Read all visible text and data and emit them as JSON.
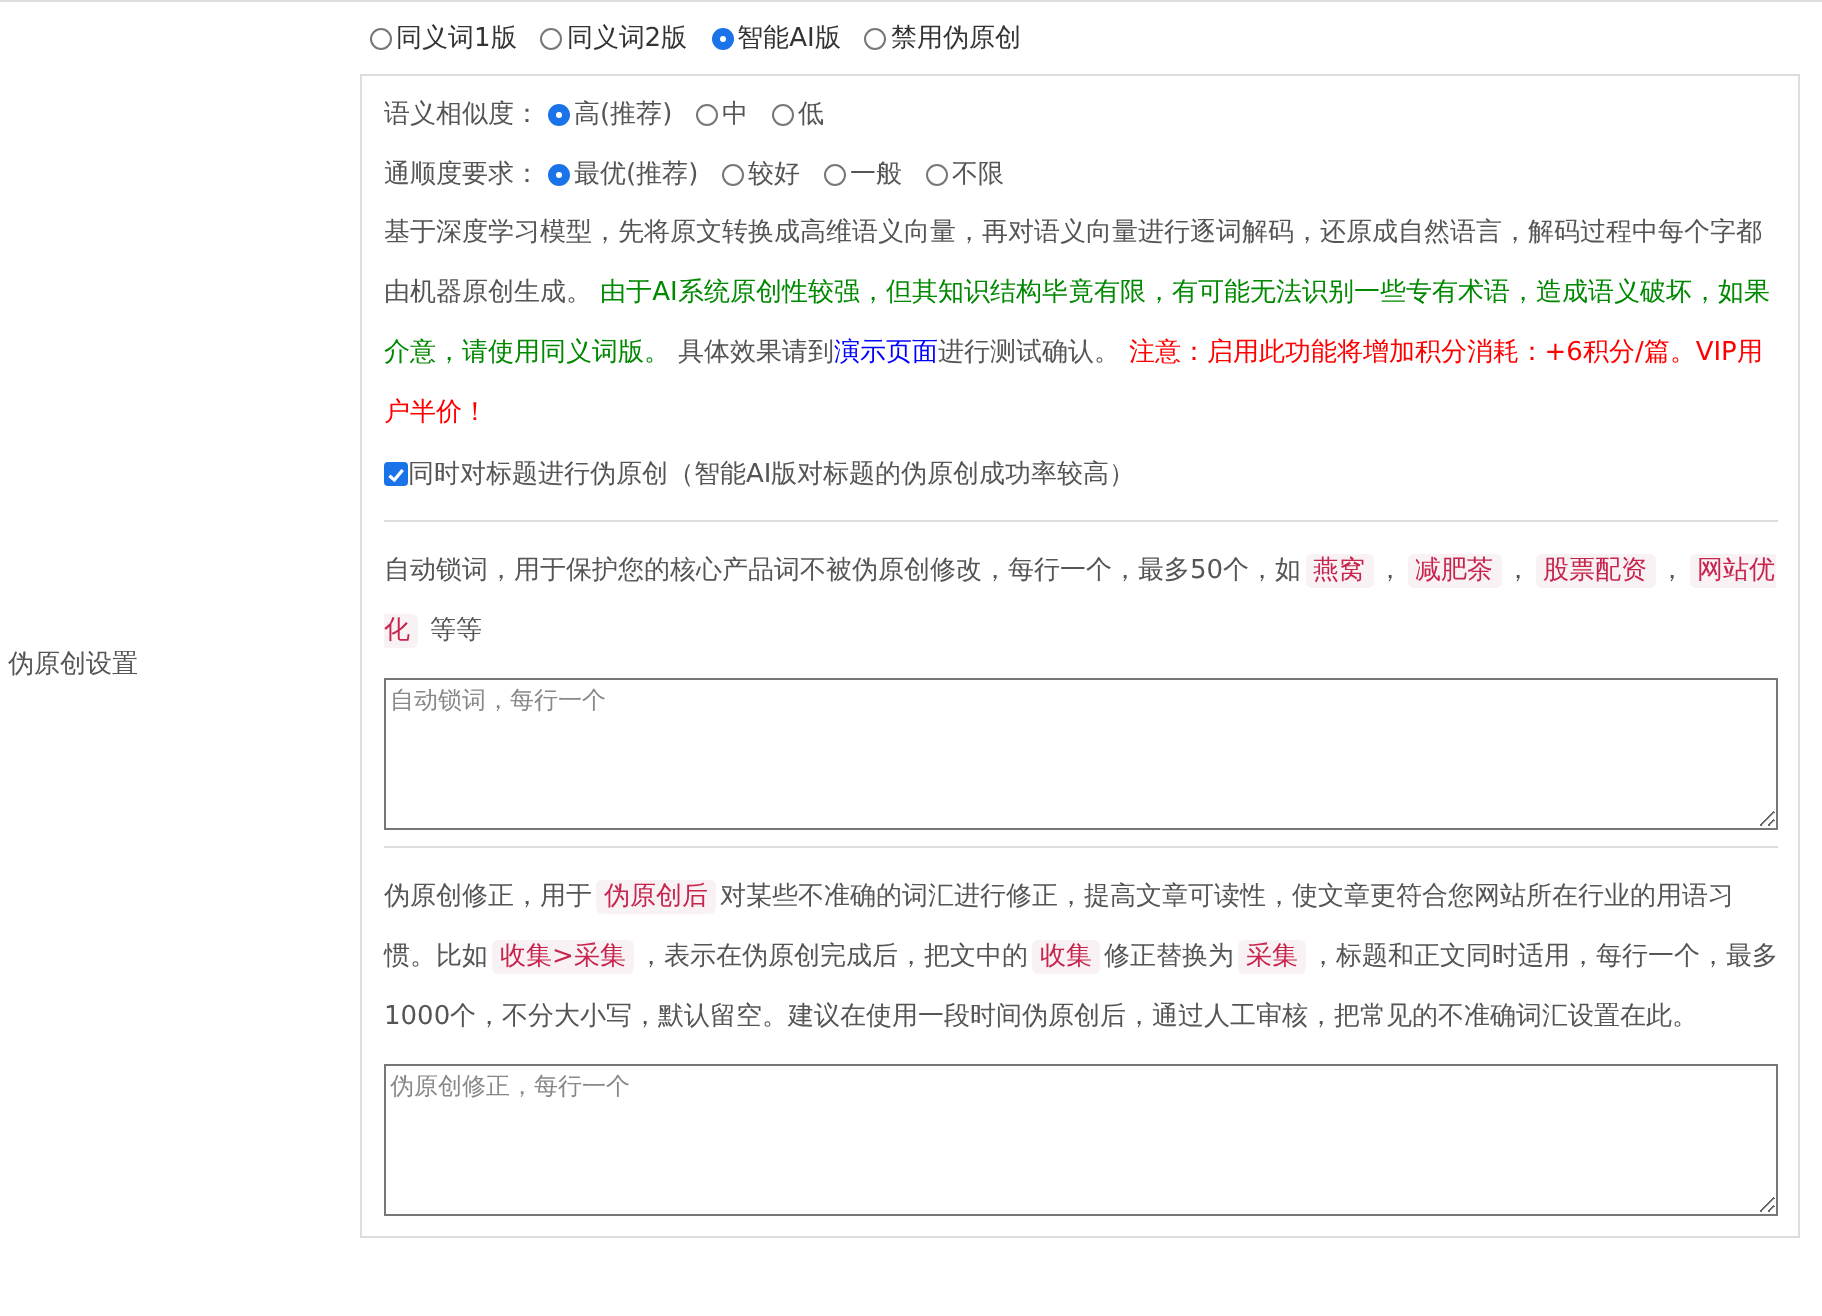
{
  "version_options": [
    {
      "label": "同义词1版",
      "selected": false
    },
    {
      "label": "同义词2版",
      "selected": false
    },
    {
      "label": "智能AI版",
      "selected": true
    },
    {
      "label": "禁用伪原创",
      "selected": false
    }
  ],
  "side_label": "伪原创设置",
  "ai_panel": {
    "settings": [
      {
        "label": "语义相似度：",
        "options": [
          {
            "label": "高(推荐)",
            "selected": true
          },
          {
            "label": "中",
            "selected": false
          },
          {
            "label": "低",
            "selected": false
          }
        ]
      },
      {
        "label": "通顺度要求：",
        "options": [
          {
            "label": "最优(推荐)",
            "selected": true
          },
          {
            "label": "较好",
            "selected": false
          },
          {
            "label": "一般",
            "selected": false
          },
          {
            "label": "不限",
            "selected": false
          }
        ]
      }
    ],
    "description": [
      {
        "kind": "text",
        "text": "基于深度学习模型，先将原文转换成高维语义向量，再对语义向量进行逐词解码，还原成自然语言，解码过程中每个字都由机器原创生成。 "
      },
      {
        "kind": "green",
        "text": "由于AI系统原创性较强，但其知识结构毕竟有限，有可能无法识别一些专有术语，造成语义破坏，如果介意，请使用同义词版。"
      },
      {
        "kind": "text",
        "text": " 具体效果请到"
      },
      {
        "kind": "link",
        "text": "演示页面"
      },
      {
        "kind": "text",
        "text": "进行测试确认。 "
      },
      {
        "kind": "red",
        "text": "注意：启用此功能将增加积分消耗：+6积分/篇。VIP用户半价！"
      }
    ],
    "title_checkbox": {
      "label": "同时对标题进行伪原创（智能AI版对标题的伪原创成功率较高）",
      "checked": true
    }
  },
  "lock_words": {
    "description": [
      {
        "kind": "text",
        "text": "自动锁词，用于保护您的核心产品词不被伪原创修改，每行一个，最多50个，如"
      },
      {
        "kind": "tag",
        "text": "燕窝"
      },
      {
        "kind": "text",
        "text": "，"
      },
      {
        "kind": "tag",
        "text": "减肥茶"
      },
      {
        "kind": "text",
        "text": "，"
      },
      {
        "kind": "tag",
        "text": "股票配资"
      },
      {
        "kind": "text",
        "text": "，"
      },
      {
        "kind": "tag",
        "text": "网站优化"
      },
      {
        "kind": "text",
        "text": " 等等"
      }
    ],
    "placeholder": "自动锁词，每行一个"
  },
  "correction": {
    "description": [
      {
        "kind": "text",
        "text": "伪原创修正，用于"
      },
      {
        "kind": "tag",
        "text": "伪原创后"
      },
      {
        "kind": "text",
        "text": "对某些不准确的词汇进行修正，提高文章可读性，使文章更符合您网站所在行业的用语习惯。比如"
      },
      {
        "kind": "tag",
        "text": "收集>采集"
      },
      {
        "kind": "text",
        "text": "，表示在伪原创完成后，把文中的"
      },
      {
        "kind": "tag",
        "text": "收集"
      },
      {
        "kind": "text",
        "text": "修正替换为"
      },
      {
        "kind": "tag",
        "text": "采集"
      },
      {
        "kind": "text",
        "text": "，标题和正文同时适用，每行一个，最多1000个，不分大小写，默认留空。建议在使用一段时间伪原创后，通过人工审核，把常见的不准确词汇设置在此。"
      }
    ],
    "placeholder": "伪原创修正，每行一个"
  }
}
